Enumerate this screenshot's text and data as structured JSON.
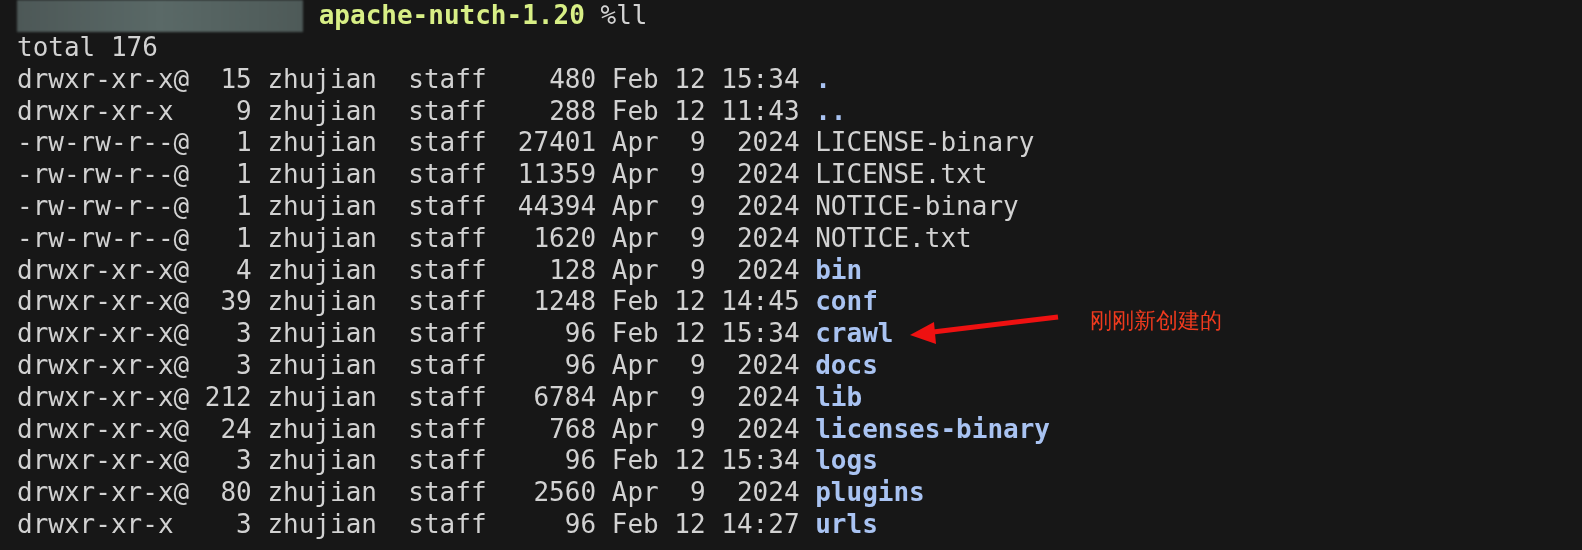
{
  "prompt": {
    "directory": "apache-nutch-1.20",
    "command": "%ll"
  },
  "total": "total 176",
  "entries": [
    {
      "perms": "drwxr-xr-x@",
      "links": "15",
      "owner": "zhujian",
      "group": "staff",
      "size": "480",
      "date": "Feb 12 15:34",
      "name": ".",
      "kind": "dir"
    },
    {
      "perms": "drwxr-xr-x",
      "links": "9",
      "owner": "zhujian",
      "group": "staff",
      "size": "288",
      "date": "Feb 12 11:43",
      "name": "..",
      "kind": "dir"
    },
    {
      "perms": "-rw-rw-r--@",
      "links": "1",
      "owner": "zhujian",
      "group": "staff",
      "size": "27401",
      "date": "Apr  9  2024",
      "name": "LICENSE-binary",
      "kind": "file"
    },
    {
      "perms": "-rw-rw-r--@",
      "links": "1",
      "owner": "zhujian",
      "group": "staff",
      "size": "11359",
      "date": "Apr  9  2024",
      "name": "LICENSE.txt",
      "kind": "file"
    },
    {
      "perms": "-rw-rw-r--@",
      "links": "1",
      "owner": "zhujian",
      "group": "staff",
      "size": "44394",
      "date": "Apr  9  2024",
      "name": "NOTICE-binary",
      "kind": "file"
    },
    {
      "perms": "-rw-rw-r--@",
      "links": "1",
      "owner": "zhujian",
      "group": "staff",
      "size": "1620",
      "date": "Apr  9  2024",
      "name": "NOTICE.txt",
      "kind": "file"
    },
    {
      "perms": "drwxr-xr-x@",
      "links": "4",
      "owner": "zhujian",
      "group": "staff",
      "size": "128",
      "date": "Apr  9  2024",
      "name": "bin",
      "kind": "dir"
    },
    {
      "perms": "drwxr-xr-x@",
      "links": "39",
      "owner": "zhujian",
      "group": "staff",
      "size": "1248",
      "date": "Feb 12 14:45",
      "name": "conf",
      "kind": "dir"
    },
    {
      "perms": "drwxr-xr-x@",
      "links": "3",
      "owner": "zhujian",
      "group": "staff",
      "size": "96",
      "date": "Feb 12 15:34",
      "name": "crawl",
      "kind": "dir"
    },
    {
      "perms": "drwxr-xr-x@",
      "links": "3",
      "owner": "zhujian",
      "group": "staff",
      "size": "96",
      "date": "Apr  9  2024",
      "name": "docs",
      "kind": "dir"
    },
    {
      "perms": "drwxr-xr-x@",
      "links": "212",
      "owner": "zhujian",
      "group": "staff",
      "size": "6784",
      "date": "Apr  9  2024",
      "name": "lib",
      "kind": "dir"
    },
    {
      "perms": "drwxr-xr-x@",
      "links": "24",
      "owner": "zhujian",
      "group": "staff",
      "size": "768",
      "date": "Apr  9  2024",
      "name": "licenses-binary",
      "kind": "dir"
    },
    {
      "perms": "drwxr-xr-x@",
      "links": "3",
      "owner": "zhujian",
      "group": "staff",
      "size": "96",
      "date": "Feb 12 15:34",
      "name": "logs",
      "kind": "dir"
    },
    {
      "perms": "drwxr-xr-x@",
      "links": "80",
      "owner": "zhujian",
      "group": "staff",
      "size": "2560",
      "date": "Apr  9  2024",
      "name": "plugins",
      "kind": "dir"
    },
    {
      "perms": "drwxr-xr-x",
      "links": "3",
      "owner": "zhujian",
      "group": "staff",
      "size": "96",
      "date": "Feb 12 14:27",
      "name": "urls",
      "kind": "dir"
    }
  ],
  "annotation": {
    "text": "刚刚新创建的"
  }
}
